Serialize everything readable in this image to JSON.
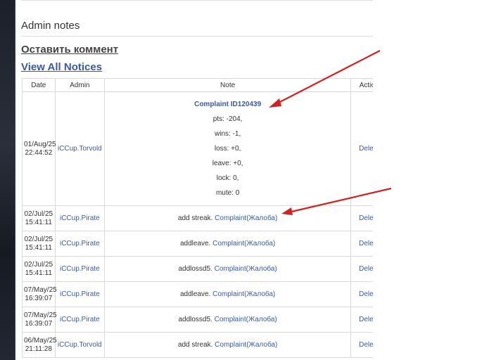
{
  "section": {
    "title": "Admin notes",
    "comment_link": "Оставить коммент",
    "notices_link": "View All Notices"
  },
  "table": {
    "headers": {
      "date": "Date",
      "admin": "Admin",
      "note": "Note",
      "action": "Action"
    },
    "first": {
      "date_line1": "01/Aug/25",
      "date_line2": "22:44:52",
      "admin": "iCCup.Torvold",
      "complaint_title": "Complaint ID120439",
      "lines": [
        "pts: -204,",
        "wins: -1,",
        "loss: +0,",
        "leave: +0,",
        "lock: 0,",
        "mute: 0"
      ],
      "action": "Delete"
    },
    "rows": [
      {
        "date_line1": "02/Jul/25",
        "date_line2": "15:41:11",
        "admin": "iCCup.Pirate",
        "note": "add streak. ",
        "link": "Complaint(Жалоба)",
        "action": "Delete"
      },
      {
        "date_line1": "02/Jul/25",
        "date_line2": "15:41:11",
        "admin": "iCCup.Pirate",
        "note": "addleave. ",
        "link": "Complaint(Жалоба)",
        "action": "Delete"
      },
      {
        "date_line1": "02/Jul/25",
        "date_line2": "15:41:11",
        "admin": "iCCup.Pirate",
        "note": "addlossd5. ",
        "link": "Complaint(Жалоба)",
        "action": "Delete"
      },
      {
        "date_line1": "07/May/25",
        "date_line2": "16:39:07",
        "admin": "iCCup.Pirate",
        "note": "addleave. ",
        "link": "Complaint(Жалоба)",
        "action": "Delete"
      },
      {
        "date_line1": "07/May/25",
        "date_line2": "16:39:07",
        "admin": "iCCup.Pirate",
        "note": "addlossd5. ",
        "link": "Complaint(Жалоба)",
        "action": "Delete"
      },
      {
        "date_line1": "06/May/25",
        "date_line2": "21:11:28",
        "admin": "iCCup.Torvold",
        "note": "add streak. ",
        "link": "Complaint(Жалоба)",
        "action": "Delete"
      }
    ]
  },
  "annotation": {
    "arrow_color": "#d42020"
  }
}
